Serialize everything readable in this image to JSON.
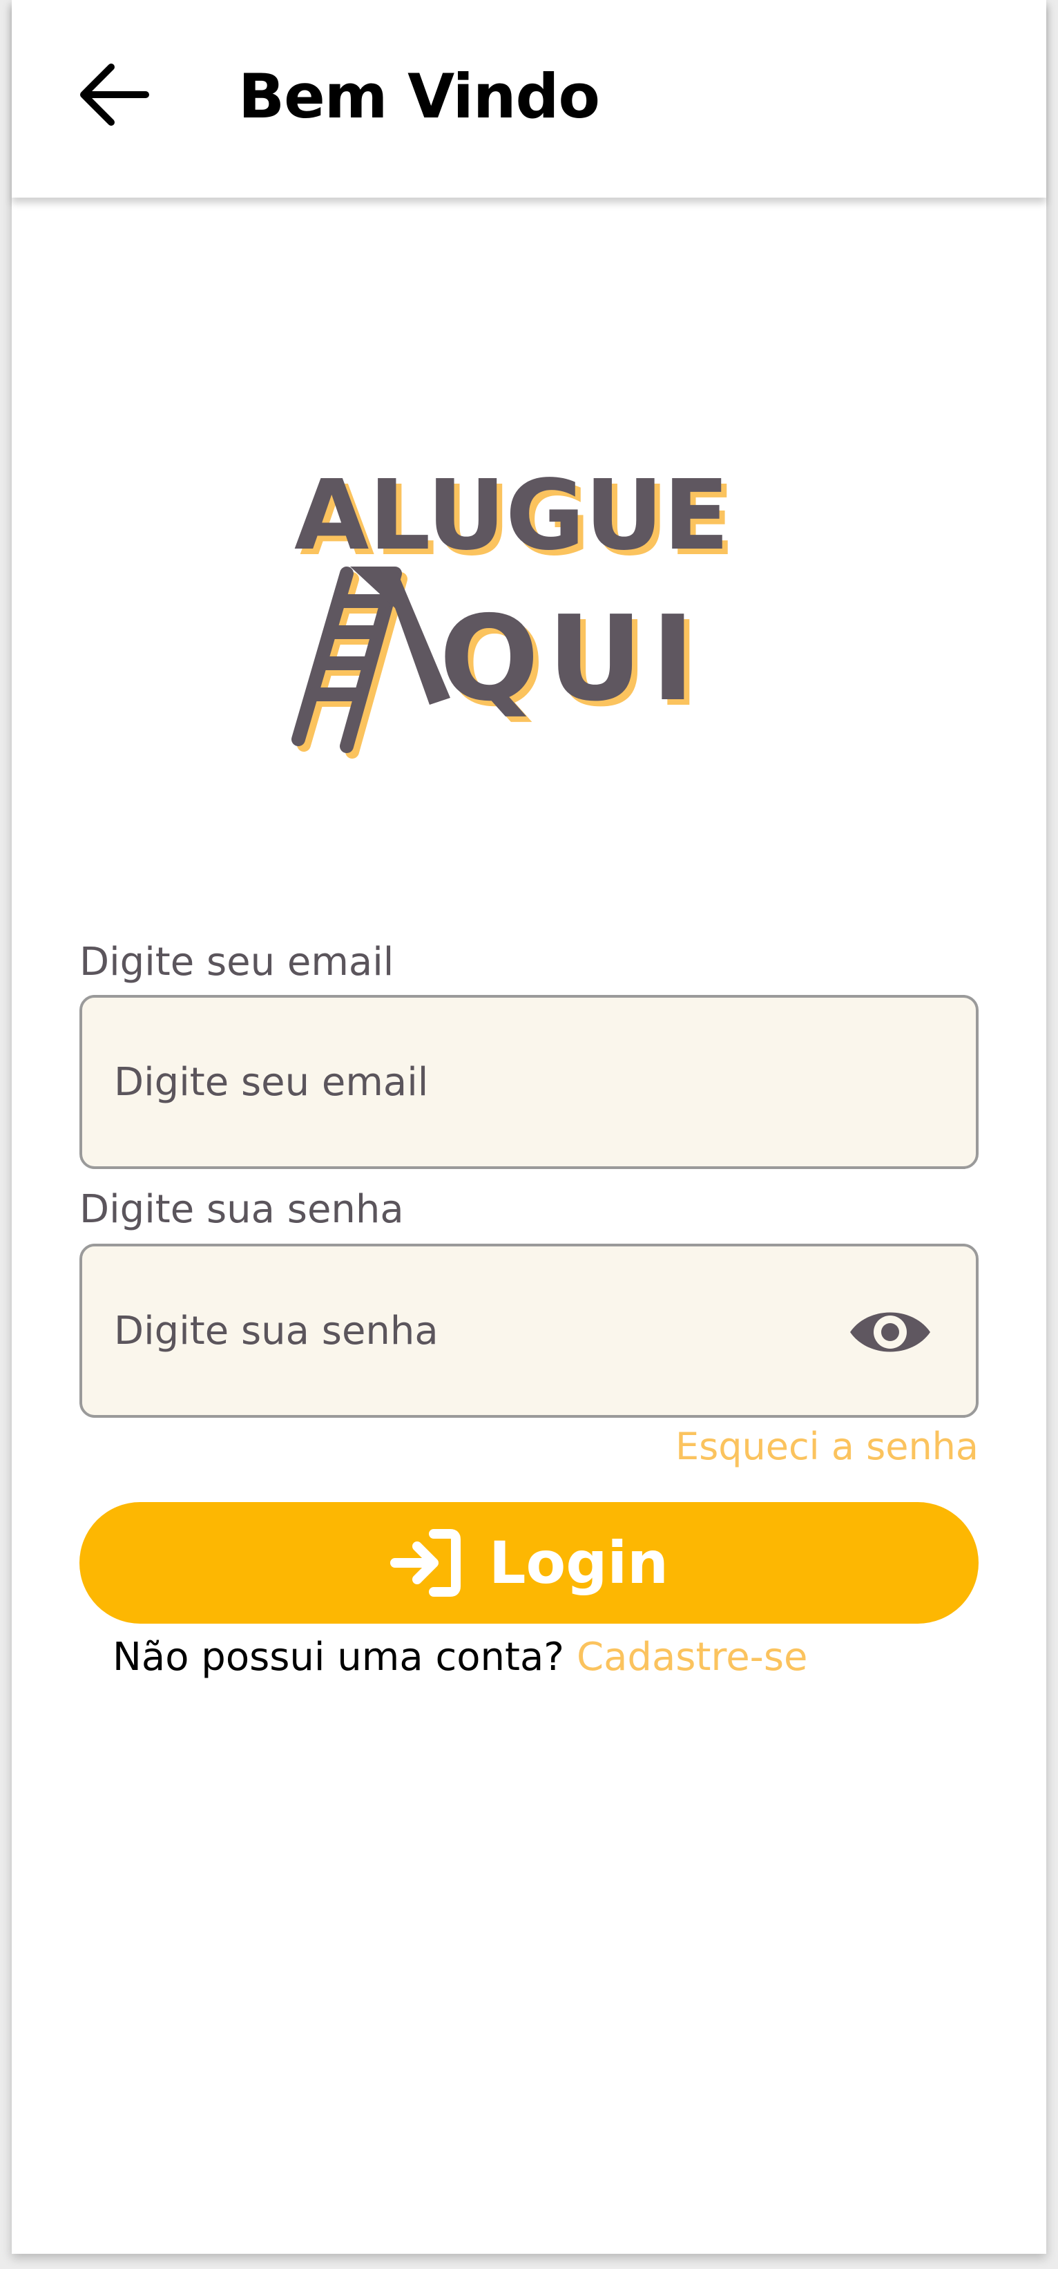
{
  "header": {
    "title": "Bem Vindo",
    "back_icon": "arrow-left-icon"
  },
  "logo": {
    "line1": "ALUGUE",
    "line2": "QUI",
    "icon": "ladder-icon",
    "text_color": "#5f5760",
    "shadow_color": "#fbc35e"
  },
  "form": {
    "email": {
      "label": "Digite seu email",
      "placeholder": "Digite seu email",
      "value": ""
    },
    "password": {
      "label": "Digite sua senha",
      "placeholder": "Digite sua senha",
      "value": "",
      "toggle_icon": "eye-icon"
    },
    "forgot_password": "Esqueci a senha",
    "login_button": {
      "label": "Login",
      "icon": "login-icon",
      "color": "#fdb702"
    },
    "signup_prompt": "Não possui uma conta?",
    "signup_link": "Cadastre-se"
  },
  "colors": {
    "accent": "#fbc35e",
    "primary": "#fdb702",
    "input_bg": "#faf6ec",
    "text_muted": "#5b555c"
  }
}
